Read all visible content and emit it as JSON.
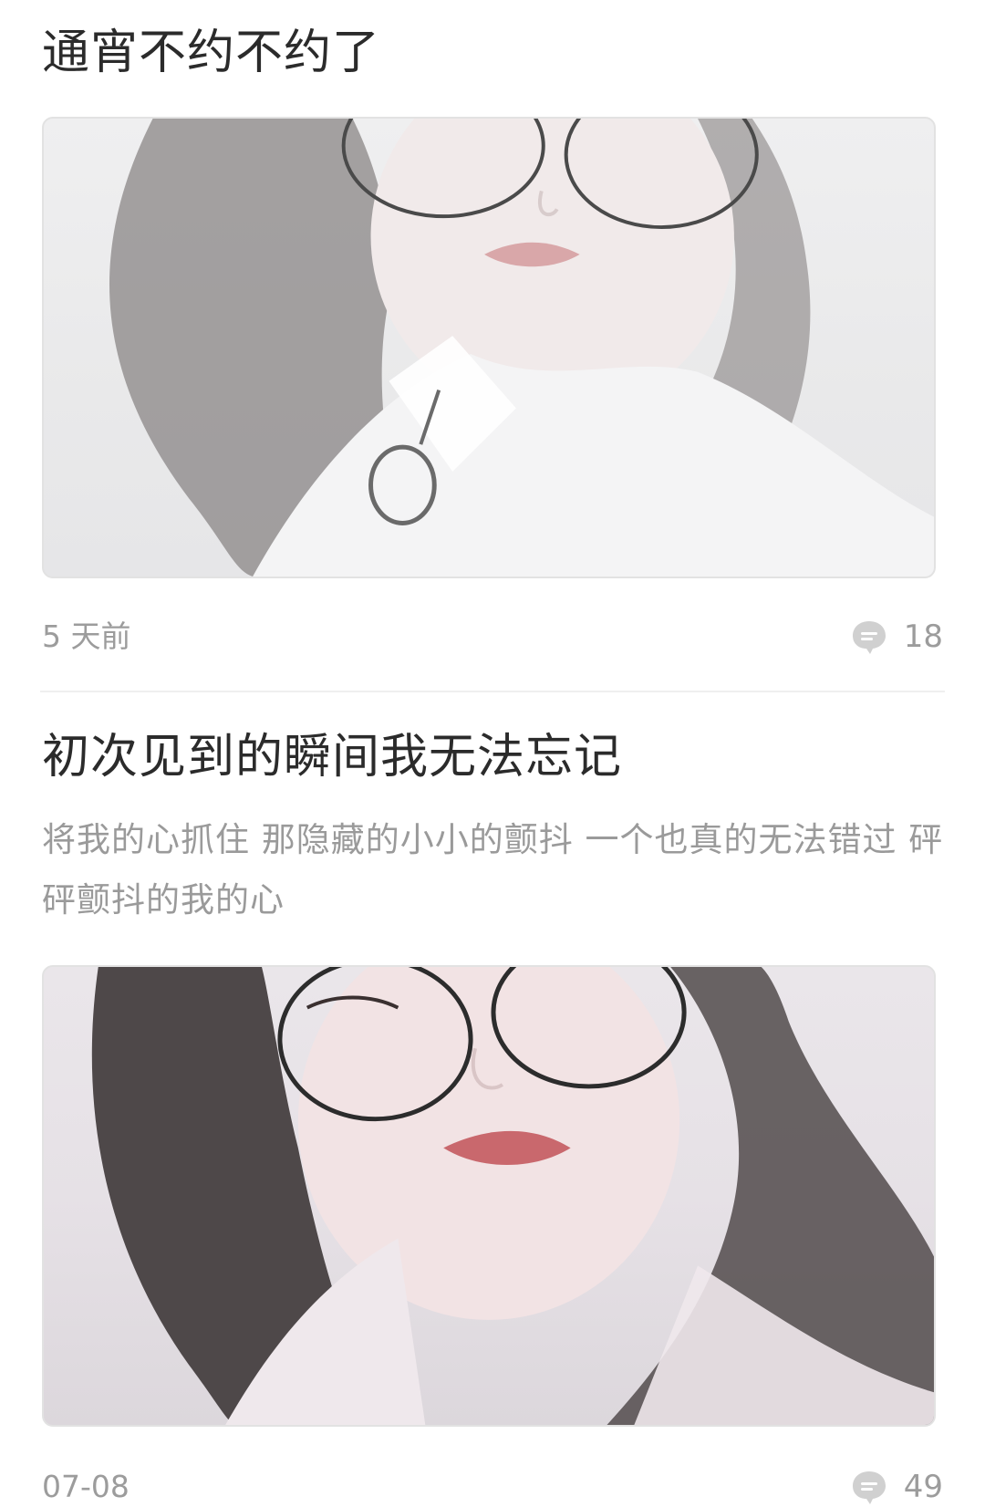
{
  "posts": [
    {
      "title": "通宵不约不约了",
      "time": "5 天前",
      "comment_count": "18"
    },
    {
      "title": "初次见到的瞬间我无法忘记",
      "excerpt": "将我的心抓住 那隐藏的小小的颤抖 一个也真的无法错过 砰砰颤抖的我的心",
      "time": "07-08",
      "comment_count": "49"
    }
  ],
  "colors": {
    "title": "#2b2b2b",
    "secondary_text": "#9a9a9a",
    "divider": "#efefef",
    "comment_icon": "#d0d0d0"
  },
  "icons": {
    "comment": "comment-bubble-icon"
  }
}
